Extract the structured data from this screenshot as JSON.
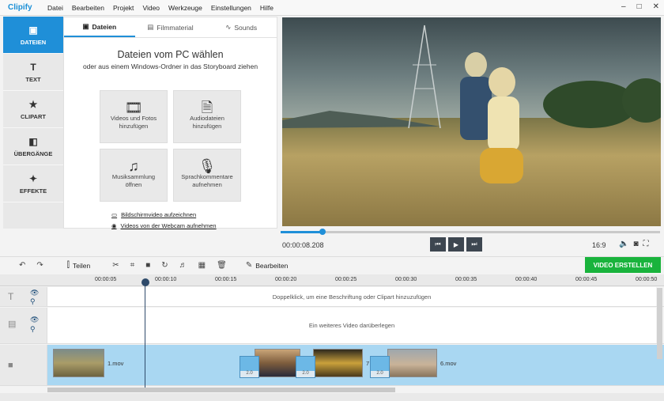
{
  "app": {
    "title": "Clipify"
  },
  "menu": [
    "Datei",
    "Bearbeiten",
    "Projekt",
    "Video",
    "Werkzeuge",
    "Einstellungen",
    "Hilfe"
  ],
  "window_controls": {
    "minimize": "–",
    "maximize": "□",
    "close": "✕"
  },
  "sidebar": {
    "items": [
      {
        "label": "DATEIEN",
        "icon": "photo-icon",
        "active": true
      },
      {
        "label": "TEXT",
        "icon": "text-icon",
        "active": false
      },
      {
        "label": "CLIPART",
        "icon": "star-icon",
        "active": false
      },
      {
        "label": "ÜBERGÄNGE",
        "icon": "transitions-icon",
        "active": false
      },
      {
        "label": "EFFEKTE",
        "icon": "magic-wand-icon",
        "active": false
      }
    ]
  },
  "panel": {
    "tabs": [
      {
        "label": "Dateien",
        "icon": "photo-icon",
        "active": true
      },
      {
        "label": "Filmmaterial",
        "icon": "film-icon",
        "active": false
      },
      {
        "label": "Sounds",
        "icon": "waveform-icon",
        "active": false
      }
    ],
    "heading": "Dateien vom PC wählen",
    "subheading": "oder aus einem Windows-Ordner in das Storyboard ziehen",
    "buttons": [
      {
        "label1": "Videos und Fotos",
        "label2": "hinzufügen",
        "icon": "media-icon"
      },
      {
        "label1": "Audiodateien",
        "label2": "hinzufügen",
        "icon": "audio-file-icon"
      },
      {
        "label1": "Musiksammlung",
        "label2": "öffnen",
        "icon": "music-notes-icon"
      },
      {
        "label1": "Sprachkommentare",
        "label2": "aufnehmen",
        "icon": "microphone-icon"
      }
    ],
    "links": [
      "Bildschirmvideo aufzeichnen",
      "Videos von der Webcam aufnehmen"
    ]
  },
  "player": {
    "timecode": "00:00:08.208",
    "progress": 0.11,
    "aspect_ratio": "16:9",
    "controls": [
      "previous-icon",
      "play-icon",
      "next-icon"
    ],
    "right_icons": [
      "volume-icon",
      "camera-icon",
      "fullscreen-icon"
    ]
  },
  "toolbar": {
    "split_label": "Teilen",
    "edit_label": "Bearbeiten",
    "create_label": "VIDEO ERSTELLEN"
  },
  "timeline": {
    "ticks": [
      "00:00:05",
      "00:00:10",
      "00:00:15",
      "00:00:20",
      "00:00:25",
      "00:00:30",
      "00:00:35",
      "00:00:40",
      "00:00:45",
      "00:00:50"
    ],
    "text_track_hint": "Doppelklick, um eine Beschriftung oder Clipart hinzuzufügen",
    "overlay_track_hint": "Ein weiteres Video darüberlegen",
    "clips": [
      {
        "name": "1.mov"
      },
      {
        "name": "7"
      },
      {
        "name": "6.mov"
      }
    ],
    "transition_duration": "2.0"
  },
  "colors": {
    "accent": "#1f8fd8",
    "create": "#19b33c",
    "video_track": "#a9d7f2"
  }
}
